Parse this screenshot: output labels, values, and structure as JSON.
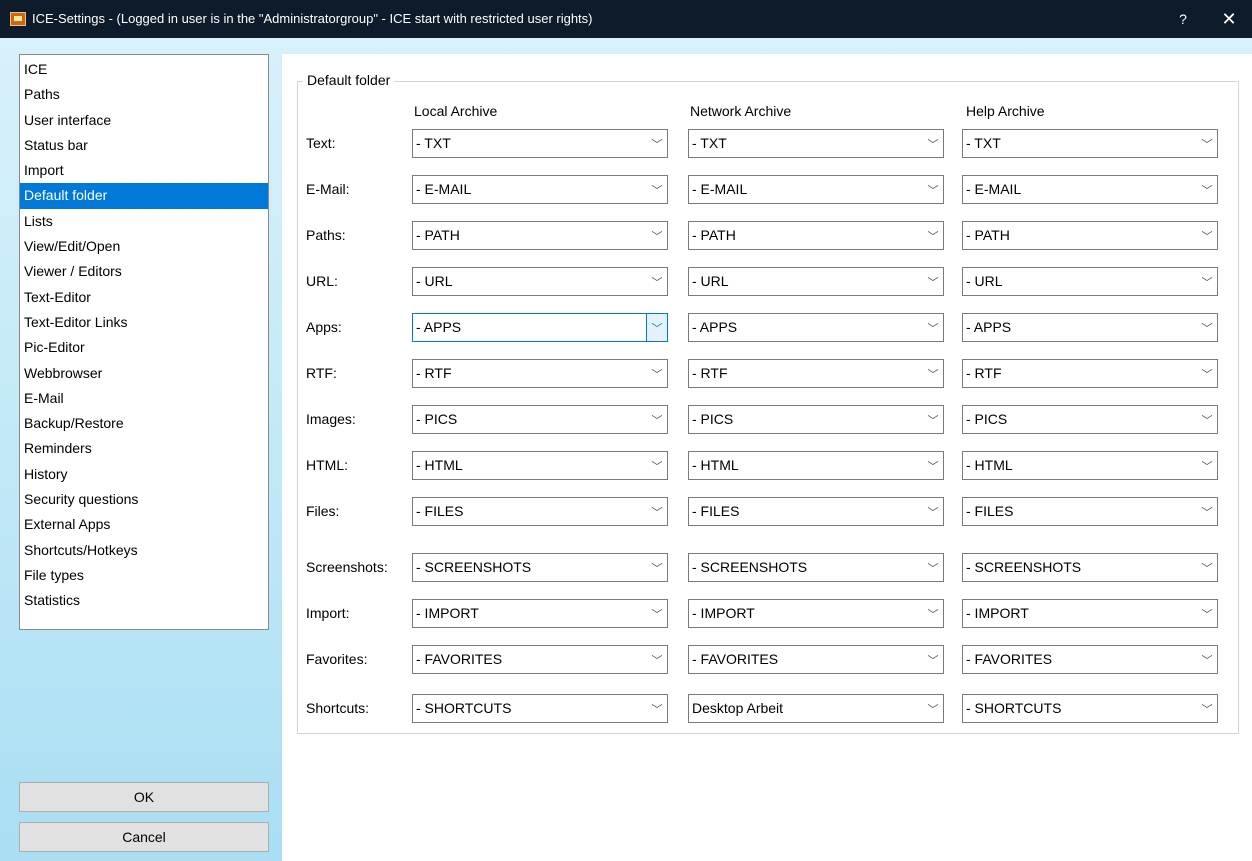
{
  "window": {
    "title": "ICE-Settings - (Logged in user is in the \"Administratorgroup\" - ICE start with restricted user rights)",
    "help": "?",
    "close": "✕"
  },
  "nav": {
    "selected_index": 5,
    "items": [
      "ICE",
      "Paths",
      "User interface",
      "Status bar",
      "Import",
      "Default folder",
      "Lists",
      "View/Edit/Open",
      "Viewer / Editors",
      "Text-Editor",
      "Text-Editor Links",
      "Pic-Editor",
      "Webbrowser",
      "E-Mail",
      "Backup/Restore",
      "Reminders",
      "History",
      "Security questions",
      "External Apps",
      "Shortcuts/Hotkeys",
      "File types",
      "Statistics"
    ]
  },
  "buttons": {
    "ok": "OK",
    "cancel": "Cancel"
  },
  "group": {
    "title": "Default folder",
    "columns": [
      "Local Archive",
      "Network Archive",
      "Help Archive"
    ],
    "focused_row": 4,
    "focused_col": 0,
    "rows": [
      {
        "label": "Text:",
        "values": [
          "- TXT",
          "- TXT",
          "- TXT"
        ]
      },
      {
        "label": "E-Mail:",
        "values": [
          "- E-MAIL",
          "- E-MAIL",
          "- E-MAIL"
        ]
      },
      {
        "label": "Paths:",
        "values": [
          "- PATH",
          "- PATH",
          "- PATH"
        ]
      },
      {
        "label": "URL:",
        "values": [
          "- URL",
          "- URL",
          "- URL"
        ]
      },
      {
        "label": "Apps:",
        "values": [
          "- APPS",
          "- APPS",
          "- APPS"
        ]
      },
      {
        "label": "RTF:",
        "values": [
          "- RTF",
          "- RTF",
          "- RTF"
        ]
      },
      {
        "label": "Images:",
        "values": [
          "- PICS",
          "- PICS",
          "- PICS"
        ]
      },
      {
        "label": "HTML:",
        "values": [
          "- HTML",
          "- HTML",
          "- HTML"
        ]
      },
      {
        "label": "Files:",
        "values": [
          "- FILES",
          "- FILES",
          "- FILES"
        ]
      },
      {
        "label": "Screenshots:",
        "values": [
          "- SCREENSHOTS",
          "- SCREENSHOTS",
          "- SCREENSHOTS"
        ]
      },
      {
        "label": "Import:",
        "values": [
          "- IMPORT",
          "- IMPORT",
          "- IMPORT"
        ]
      },
      {
        "label": "Favorites:",
        "values": [
          "- FAVORITES",
          "- FAVORITES",
          "- FAVORITES"
        ]
      },
      {
        "label": "Shortcuts:",
        "values": [
          "- SHORTCUTS",
          "Desktop Arbeit",
          "- SHORTCUTS"
        ]
      }
    ]
  }
}
